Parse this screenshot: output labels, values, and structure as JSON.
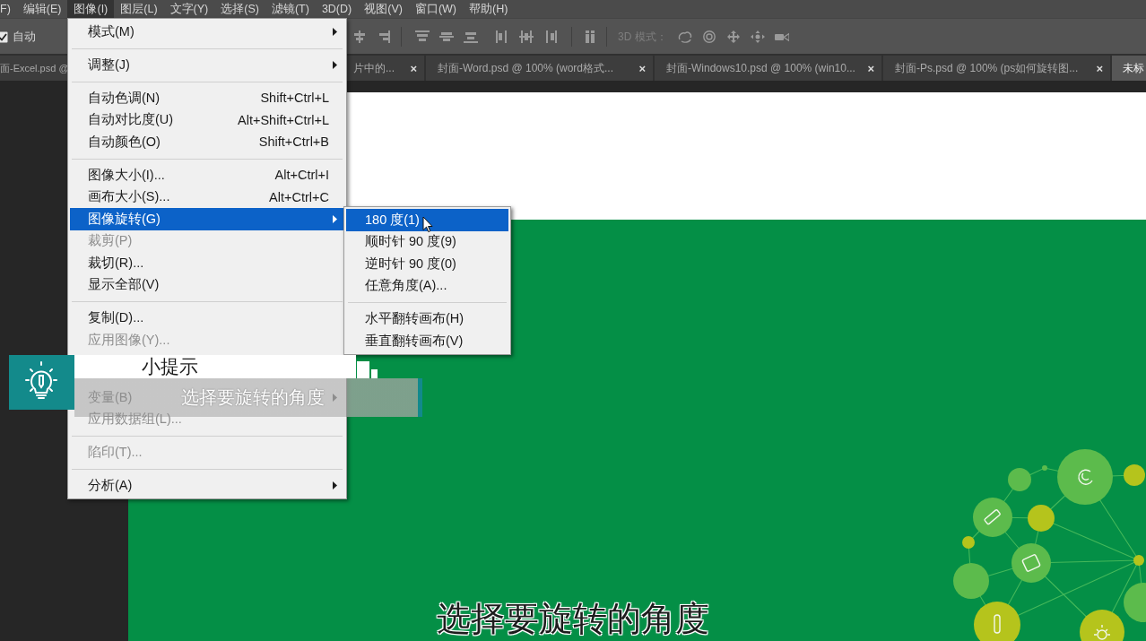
{
  "menu_bar": {
    "items": [
      {
        "label": "F)",
        "selected": false
      },
      {
        "label": "编辑(E)",
        "selected": false
      },
      {
        "label": "图像(I)",
        "selected": true
      },
      {
        "label": "图层(L)",
        "selected": false
      },
      {
        "label": "文字(Y)",
        "selected": false
      },
      {
        "label": "选择(S)",
        "selected": false
      },
      {
        "label": "滤镜(T)",
        "selected": false
      },
      {
        "label": "3D(D)",
        "selected": false
      },
      {
        "label": "视图(V)",
        "selected": false
      },
      {
        "label": "窗口(W)",
        "selected": false
      },
      {
        "label": "帮助(H)",
        "selected": false
      }
    ]
  },
  "options_bar": {
    "auto_select": {
      "label": "自动",
      "checked": true
    },
    "mode_label": "3D 模式："
  },
  "document_tabs": [
    {
      "label": "面-Excel.psd @",
      "selected": false
    },
    {
      "label": "片中的...",
      "close": "×",
      "selected": false
    },
    {
      "label": "封面-Word.psd @ 100% (word格式...",
      "close": "×",
      "selected": false
    },
    {
      "label": "封面-Windows10.psd @ 100% (win10...",
      "close": "×",
      "selected": false
    },
    {
      "label": "封面-Ps.psd @ 100% (ps如何旋转图...",
      "close": "×",
      "selected": false
    },
    {
      "label": "未标",
      "selected": true
    }
  ],
  "image_menu": {
    "items": [
      {
        "kind": "item",
        "label": "模式(M)",
        "submenu": true,
        "disabled": false,
        "selected": false
      },
      {
        "kind": "separator"
      },
      {
        "kind": "item",
        "label": "调整(J)",
        "submenu": true,
        "disabled": false,
        "selected": false
      },
      {
        "kind": "separator"
      },
      {
        "kind": "item",
        "label": "自动色调(N)",
        "shortcut": "Shift+Ctrl+L",
        "submenu": false,
        "disabled": false,
        "selected": false
      },
      {
        "kind": "item",
        "label": "自动对比度(U)",
        "shortcut": "Alt+Shift+Ctrl+L",
        "submenu": false,
        "disabled": false,
        "selected": false
      },
      {
        "kind": "item",
        "label": "自动颜色(O)",
        "shortcut": "Shift+Ctrl+B",
        "submenu": false,
        "disabled": false,
        "selected": false
      },
      {
        "kind": "separator"
      },
      {
        "kind": "item",
        "label": "图像大小(I)...",
        "shortcut": "Alt+Ctrl+I",
        "submenu": false,
        "disabled": false,
        "selected": false
      },
      {
        "kind": "item",
        "label": "画布大小(S)...",
        "shortcut": "Alt+Ctrl+C",
        "submenu": false,
        "disabled": false,
        "selected": false
      },
      {
        "kind": "item",
        "label": "图像旋转(G)",
        "submenu": true,
        "disabled": false,
        "selected": true
      },
      {
        "kind": "item",
        "label": "裁剪(P)",
        "submenu": false,
        "disabled": true,
        "selected": false
      },
      {
        "kind": "item",
        "label": "裁切(R)...",
        "submenu": false,
        "disabled": false,
        "selected": false
      },
      {
        "kind": "item",
        "label": "显示全部(V)",
        "submenu": false,
        "disabled": false,
        "selected": false
      },
      {
        "kind": "separator"
      },
      {
        "kind": "item",
        "label": "复制(D)...",
        "submenu": false,
        "disabled": false,
        "selected": false
      },
      {
        "kind": "item",
        "label": "应用图像(Y)...",
        "submenu": false,
        "disabled": true,
        "selected": false
      },
      {
        "kind": "covered"
      },
      {
        "kind": "item",
        "label": "变量(B)",
        "submenu": true,
        "disabled": true,
        "selected": false
      },
      {
        "kind": "item",
        "label": "应用数据组(L)...",
        "submenu": false,
        "disabled": true,
        "selected": false
      },
      {
        "kind": "separator"
      },
      {
        "kind": "item",
        "label": "陷印(T)...",
        "submenu": false,
        "disabled": true,
        "selected": false
      },
      {
        "kind": "separator"
      },
      {
        "kind": "item",
        "label": "分析(A)",
        "submenu": true,
        "disabled": false,
        "selected": false
      }
    ]
  },
  "rotate_submenu": {
    "items": [
      {
        "kind": "item",
        "label": "180 度(1)",
        "selected": true
      },
      {
        "kind": "item",
        "label": "顺时针 90 度(9)",
        "selected": false
      },
      {
        "kind": "item",
        "label": "逆时针 90 度(0)",
        "selected": false
      },
      {
        "kind": "item",
        "label": "任意角度(A)...",
        "selected": false
      },
      {
        "kind": "separator"
      },
      {
        "kind": "item",
        "label": "水平翻转画布(H)",
        "selected": false
      },
      {
        "kind": "item",
        "label": "垂直翻转画布(V)",
        "selected": false
      }
    ]
  },
  "tip": {
    "title": "小提示",
    "text": "选择要旋转的角度"
  },
  "subtitle": "选择要旋转的角度"
}
